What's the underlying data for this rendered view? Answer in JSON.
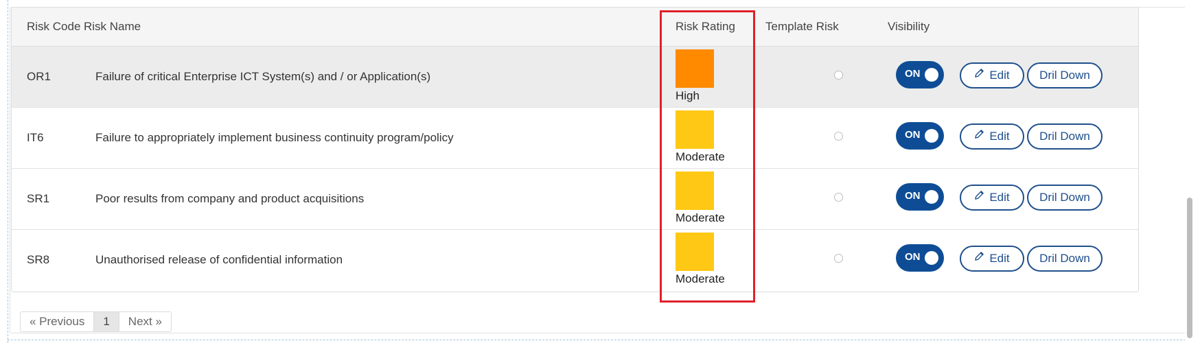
{
  "table": {
    "headers": {
      "code": "Risk Code",
      "name": "Risk Name",
      "rating": "Risk Rating",
      "template": "Template Risk",
      "visibility": "Visibility"
    },
    "rows": [
      {
        "code": "OR1",
        "name": "Failure of critical Enterprise ICT System(s) and / or Application(s)",
        "rating": "High",
        "rating_color": "#ff8a00",
        "template_selected": false,
        "visibility": "ON",
        "edit": "Edit",
        "drill": "Dril Down"
      },
      {
        "code": "IT6",
        "name": "Failure to appropriately implement business continuity program/policy",
        "rating": "Moderate",
        "rating_color": "#ffc815",
        "template_selected": false,
        "visibility": "ON",
        "edit": "Edit",
        "drill": "Dril Down"
      },
      {
        "code": "SR1",
        "name": "Poor results from company and product acquisitions",
        "rating": "Moderate",
        "rating_color": "#ffc815",
        "template_selected": false,
        "visibility": "ON",
        "edit": "Edit",
        "drill": "Dril Down"
      },
      {
        "code": "SR8",
        "name": "Unauthorised release of confidential information",
        "rating": "Moderate",
        "rating_color": "#ffc815",
        "template_selected": false,
        "visibility": "ON",
        "edit": "Edit",
        "drill": "Dril Down"
      }
    ]
  },
  "pagination": {
    "previous": "«  Previous",
    "current": "1",
    "next": "Next  »"
  },
  "colors": {
    "toggle_on": "#0e4d96",
    "button_border": "#1e4f8c",
    "highlight": "#e0202a",
    "rating_high": "#ff8a00",
    "rating_moderate": "#ffc815"
  }
}
